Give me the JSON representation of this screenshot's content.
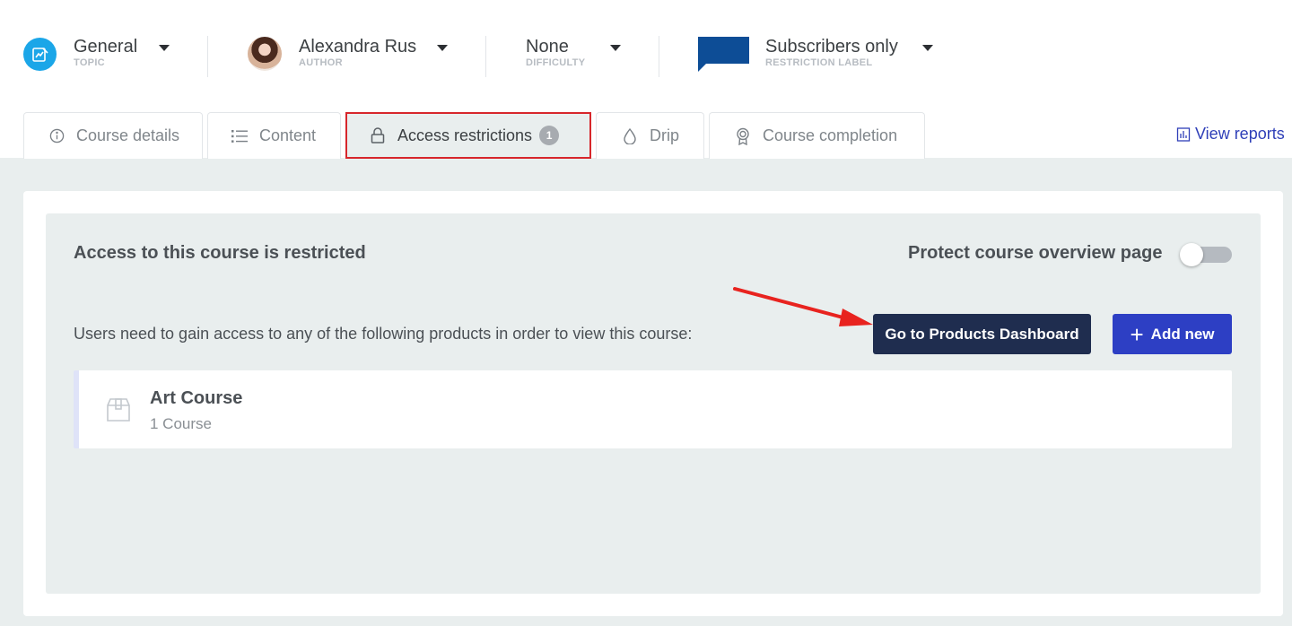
{
  "meta": {
    "topic": {
      "value": "General",
      "label": "TOPIC"
    },
    "author": {
      "value": "Alexandra Rus",
      "label": "AUTHOR"
    },
    "difficulty": {
      "value": "None",
      "label": "DIFFICULTY"
    },
    "restriction": {
      "value": "Subscribers only",
      "label": "RESTRICTION LABEL",
      "flag_color": "#0d4d96"
    }
  },
  "tabs": [
    {
      "label": "Course details",
      "icon": "info-icon"
    },
    {
      "label": "Content",
      "icon": "list-icon"
    },
    {
      "label": "Access restrictions",
      "icon": "lock-icon",
      "badge": "1",
      "active": true
    },
    {
      "label": "Drip",
      "icon": "drop-icon"
    },
    {
      "label": "Course completion",
      "icon": "award-icon"
    }
  ],
  "view_reports": "View reports",
  "panel": {
    "title": "Access to this course is restricted",
    "protect_label": "Protect course overview page",
    "protect_enabled": false,
    "users_text": "Users need to gain access to any of the following products in order to view this course:",
    "dashboard_button": "Go to Products Dashboard",
    "add_button": "Add new"
  },
  "products": [
    {
      "name": "Art Course",
      "subtitle": "1 Course",
      "icon": "box-icon"
    }
  ],
  "colors": {
    "accent_blue": "#2d3fc4",
    "dark_navy": "#1f2d4f",
    "topic_blue": "#1ba6e8",
    "highlight_red": "#d7262b",
    "panel_bg": "#e9eeee"
  }
}
